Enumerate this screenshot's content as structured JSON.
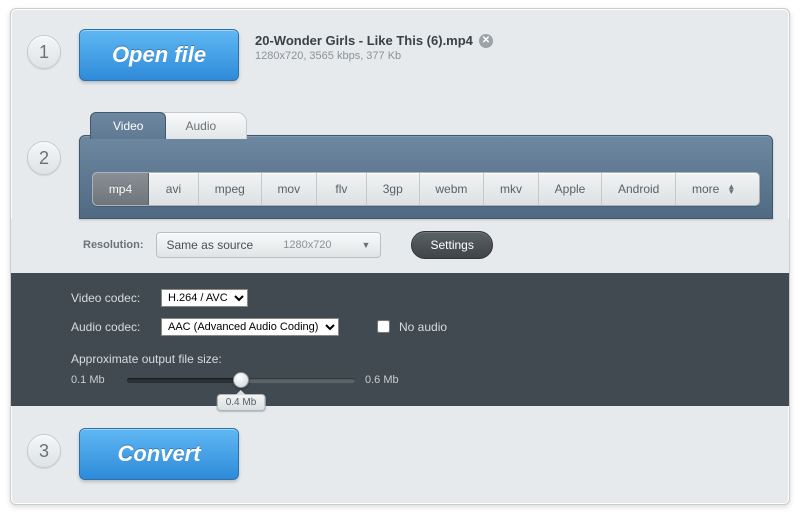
{
  "step_numbers": {
    "one": "1",
    "two": "2",
    "three": "3"
  },
  "open_file_label": "Open file",
  "file": {
    "name": "20-Wonder Girls - Like This (6).mp4",
    "info": "1280x720, 3565 kbps, 377 Kb"
  },
  "tabs": {
    "video": "Video",
    "audio": "Audio"
  },
  "formats": {
    "mp4": "mp4",
    "avi": "avi",
    "mpeg": "mpeg",
    "mov": "mov",
    "flv": "flv",
    "threegp": "3gp",
    "webm": "webm",
    "mkv": "mkv",
    "apple": "Apple",
    "android": "Android",
    "more": "more"
  },
  "resolution": {
    "label": "Resolution:",
    "selected": "Same as source",
    "dim": "1280x720"
  },
  "settings_label": "Settings",
  "codec": {
    "video_label": "Video codec:",
    "video_value": "H.264 / AVC",
    "audio_label": "Audio codec:",
    "audio_value": "AAC (Advanced Audio Coding)",
    "no_audio_label": "No audio"
  },
  "filesize": {
    "title": "Approximate output file size:",
    "min": "0.1 Mb",
    "max": "0.6 Mb",
    "current": "0.4 Mb"
  },
  "convert_label": "Convert"
}
